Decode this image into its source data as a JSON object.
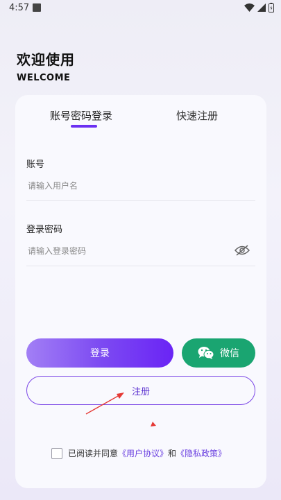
{
  "status_bar": {
    "time": "4:57"
  },
  "header": {
    "title": "欢迎使用",
    "subtitle": "WELCOME"
  },
  "tabs": [
    {
      "label": "账号密码登录",
      "active": true
    },
    {
      "label": "快速注册",
      "active": false
    }
  ],
  "form": {
    "account": {
      "label": "账号",
      "placeholder": "请输入用户名",
      "value": ""
    },
    "password": {
      "label": "登录密码",
      "placeholder": "请输入登录密码",
      "value": ""
    }
  },
  "buttons": {
    "login": "登录",
    "wechat": "微信",
    "register": "注册"
  },
  "agreement": {
    "prefix": "已阅读并同意",
    "user_agreement": "《用户协议》",
    "conjunction": "和",
    "privacy_policy": "《隐私政策》",
    "checked": false
  },
  "colors": {
    "accent": "#6b2ff2",
    "wechat_green": "#1aa571",
    "annotation_red": "#e53935"
  },
  "icons": [
    "wifi-icon",
    "signal-icon",
    "battery-icon",
    "eye-hidden-icon",
    "wechat-icon"
  ]
}
